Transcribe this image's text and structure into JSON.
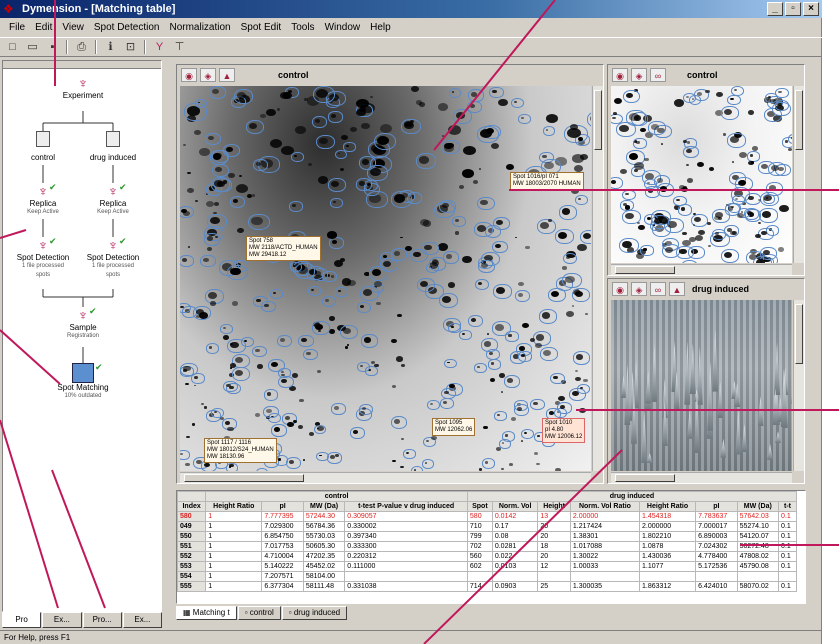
{
  "window": {
    "title": "Dymension - [Matching table]",
    "controls": [
      "_",
      "▫",
      "×"
    ]
  },
  "menu": [
    "File",
    "Edit",
    "View",
    "Spot Detection",
    "Normalization",
    "Spot Edit",
    "Tools",
    "Window",
    "Help"
  ],
  "toolbar": {
    "icons": [
      "new-icon",
      "open-icon",
      "save-icon",
      "print-icon",
      "info-icon",
      "fit-icon",
      "tool-icon",
      "tree-icon"
    ]
  },
  "tree": {
    "experiment": "Experiment",
    "groups": [
      {
        "label": "control",
        "replica": "Replica",
        "replica_sub": "Keep Active",
        "detection": "Spot Detection",
        "detection_sub": "1 file processed",
        "detection_sub2": "spots"
      },
      {
        "label": "drug induced",
        "replica": "Replica",
        "replica_sub": "Keep Active",
        "detection": "Spot Detection",
        "detection_sub": "1 file processed",
        "detection_sub2": "spots"
      }
    ],
    "sample": "Sample",
    "sample_sub": "Registration",
    "matching": "Spot Matching",
    "matching_sub": "10% outdated",
    "tabs": [
      "Pro",
      "Ex...",
      "Pro...",
      "Ex..."
    ]
  },
  "views": {
    "main_title": "control",
    "right_top_title": "control",
    "right_bottom_title": "drug induced"
  },
  "spot_labels": [
    {
      "text": "Spot 758\nMW 2118/ACTD_HUMAN\nMW 29418.12"
    },
    {
      "text": "Spot 1095\nMW 12062.06"
    },
    {
      "text": "Spot 1010\npI 4.80\nMW 12006.12"
    },
    {
      "text": "Spot 1117 / 1116\nMW 18012/S24_HUMAN\nMW 18130.96"
    },
    {
      "text": "Spot 1016/pI 071\nMW 18003/2070 HUMAN"
    }
  ],
  "table": {
    "group_headers": {
      "control": "control",
      "drug_induced": "drug induced"
    },
    "headers": [
      "Index",
      "Height Ratio",
      "pI",
      "MW (Da)",
      "t-test P-value v drug induced",
      "Spot",
      "Norm. Vol",
      "Height",
      "Norm. Vol Ratio",
      "Height Ratio",
      "pI",
      "MW (Da)",
      "t-t"
    ],
    "rows": [
      [
        "580",
        "1",
        "7.777395",
        "57244.30",
        "0.309057",
        "580",
        "0.0142",
        "13",
        "2.00000",
        "1.454318",
        "7.783637",
        "57642.03",
        "0.1"
      ],
      [
        "049",
        "1",
        "7.029300",
        "56784.36",
        "0.330002",
        "710",
        "0.17",
        "20",
        "1.217424",
        "2.000000",
        "7.000017",
        "55274.10",
        "0.1"
      ],
      [
        "550",
        "1",
        "6.854750",
        "55730.03",
        "0.397340",
        "799",
        "0.08",
        "20",
        "1.38301",
        "1.802210",
        "6.890003",
        "54120.07",
        "0.1"
      ],
      [
        "551",
        "1",
        "7.017753",
        "50605.30",
        "0.333300",
        "702",
        "0.0281",
        "18",
        "1.017088",
        "1.0878",
        "7.024302",
        "50272.48",
        "0.1"
      ],
      [
        "552",
        "1",
        "4.710004",
        "47202.35",
        "0.220312",
        "560",
        "0.022",
        "20",
        "1.30022",
        "1.430036",
        "4.778400",
        "47808.02",
        "0.1"
      ],
      [
        "553",
        "1",
        "5.140222",
        "45452.02",
        "0.111000",
        "602",
        "0.0103",
        "12",
        "1.00033",
        "1.1077",
        "5.172536",
        "45790.08",
        "0.1"
      ],
      [
        "554",
        "1",
        "7.207571",
        "58104.00",
        "",
        "",
        "",
        "",
        "",
        "",
        "",
        "",
        ""
      ],
      [
        "555",
        "1",
        "6.377304",
        "58111.48",
        "0.331038",
        "714",
        "0.0903",
        "25",
        "1.300035",
        "1.863312",
        "6.424010",
        "58070.02",
        "0.1"
      ]
    ],
    "selected_row": 0
  },
  "bottom_tabs": [
    "Matching t",
    "control",
    "drug induced"
  ],
  "status": "For Help, press F1",
  "colors": {
    "title_bar": "#0a246a",
    "callout": "#c0185a",
    "selected_row_text": "#dd2222",
    "contour": "#5a8ac8"
  }
}
